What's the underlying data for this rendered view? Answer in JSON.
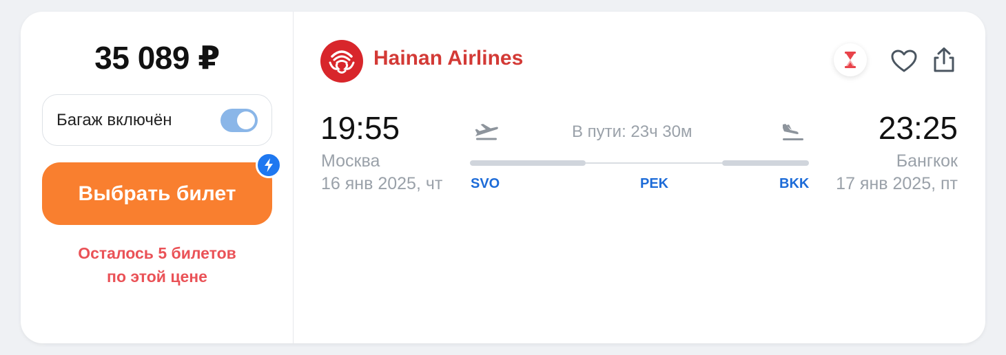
{
  "offer": {
    "price": "35 089 ₽",
    "baggage_label": "Багаж включён",
    "baggage_included": true,
    "buy_button_label": "Выбрать билет",
    "tickets_left_line1": "Осталось 5 билетов",
    "tickets_left_line2": "по этой цене"
  },
  "airline": {
    "name": "Hainan Airlines",
    "logo_icon": "hainan-airlines-logo",
    "brand_color": "#d33a36"
  },
  "actions": {
    "timer_icon": "hourglass-icon",
    "favorite_icon": "heart-icon",
    "share_icon": "share-icon"
  },
  "flight": {
    "departure": {
      "time": "19:55",
      "city": "Москва",
      "date": "16 янв 2025, чт"
    },
    "arrival": {
      "time": "23:25",
      "city": "Бангкок",
      "date": "17 янв 2025, пт"
    },
    "duration": "В пути: 23ч 30м",
    "airports": [
      "SVO",
      "PEK",
      "BKK"
    ]
  },
  "colors": {
    "accent_orange": "#f97f2f",
    "link_blue": "#1c6bd8",
    "warning_red": "#ea5257",
    "toggle_on": "#8ab6e8"
  }
}
